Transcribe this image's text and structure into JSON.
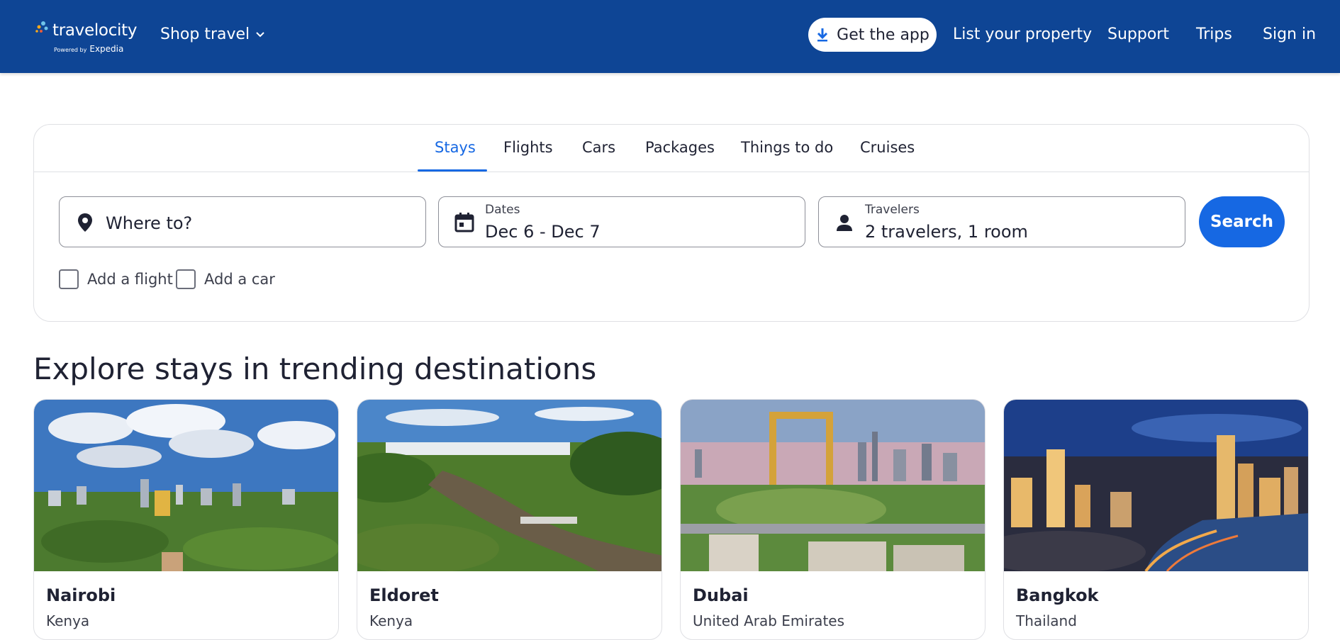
{
  "header": {
    "logo_text": "travelocity",
    "logo_sub": "Powered by",
    "logo_sub_brand": "Expedia",
    "shop_travel": "Shop travel",
    "get_app": "Get the app",
    "nav": [
      "List your property",
      "Support",
      "Trips",
      "Sign in"
    ],
    "bg_color": "#0e4595"
  },
  "search": {
    "tabs": [
      {
        "label": "Stays",
        "active": true
      },
      {
        "label": "Flights",
        "active": false
      },
      {
        "label": "Cars",
        "active": false
      },
      {
        "label": "Packages",
        "active": false
      },
      {
        "label": "Things to do",
        "active": false
      },
      {
        "label": "Cruises",
        "active": false
      }
    ],
    "destination": {
      "placeholder": "Where to?",
      "icon": "location-pin-icon"
    },
    "dates": {
      "label": "Dates",
      "value": "Dec 6 - Dec 7",
      "icon": "calendar-icon"
    },
    "travelers": {
      "label": "Travelers",
      "value": "2 travelers, 1 room",
      "icon": "person-icon"
    },
    "search_button": "Search",
    "add_flight": "Add a flight",
    "add_car": "Add a car",
    "accent": "#1668e3"
  },
  "explore": {
    "title": "Explore stays in trending destinations",
    "cards": [
      {
        "city": "Nairobi",
        "country": "Kenya"
      },
      {
        "city": "Eldoret",
        "country": "Kenya"
      },
      {
        "city": "Dubai",
        "country": "United Arab Emirates"
      },
      {
        "city": "Bangkok",
        "country": "Thailand"
      }
    ]
  }
}
